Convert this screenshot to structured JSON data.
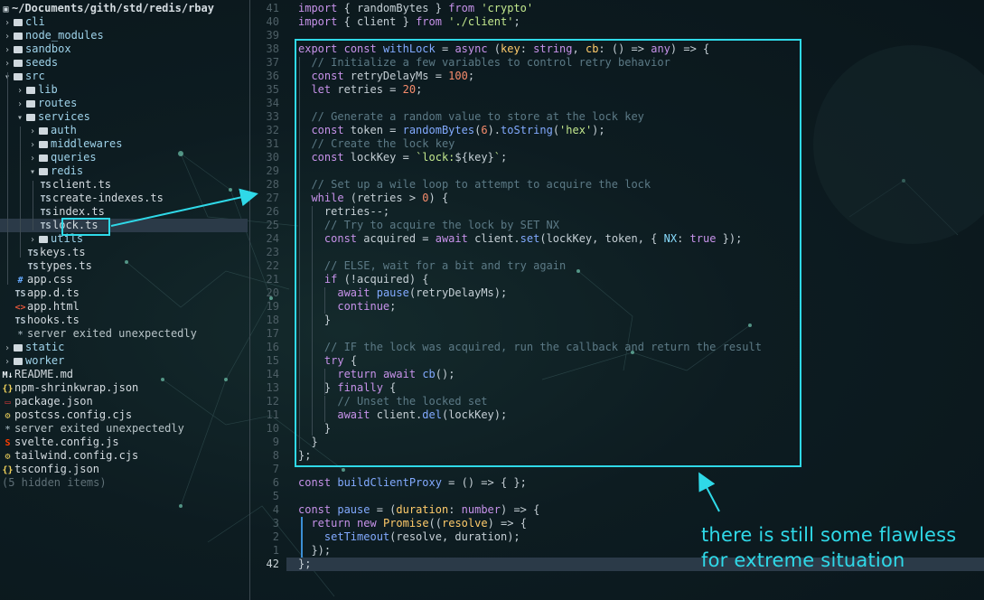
{
  "sidebar": {
    "header": "~/Documents/gith/std/redis/rbay",
    "items": [
      {
        "label": "cli",
        "type": "dir",
        "depth": 0,
        "open": false
      },
      {
        "label": "node_modules",
        "type": "dir",
        "depth": 0,
        "open": false
      },
      {
        "label": "sandbox",
        "type": "dir",
        "depth": 0,
        "open": false
      },
      {
        "label": "seeds",
        "type": "dir",
        "depth": 0,
        "open": false
      },
      {
        "label": "src",
        "type": "dir",
        "depth": 0,
        "open": true
      },
      {
        "label": "lib",
        "type": "dir",
        "depth": 1,
        "open": false
      },
      {
        "label": "routes",
        "type": "dir",
        "depth": 1,
        "open": false
      },
      {
        "label": "services",
        "type": "dir",
        "depth": 1,
        "open": true
      },
      {
        "label": "auth",
        "type": "dir",
        "depth": 2,
        "open": false
      },
      {
        "label": "middlewares",
        "type": "dir",
        "depth": 2,
        "open": false
      },
      {
        "label": "queries",
        "type": "dir",
        "depth": 2,
        "open": false
      },
      {
        "label": "redis",
        "type": "dir",
        "depth": 2,
        "open": true
      },
      {
        "label": "client.ts",
        "type": "ts",
        "depth": 3
      },
      {
        "label": "create-indexes.ts",
        "type": "ts",
        "depth": 3
      },
      {
        "label": "index.ts",
        "type": "ts",
        "depth": 3
      },
      {
        "label": "lock.ts",
        "type": "ts",
        "depth": 3,
        "selected": true
      },
      {
        "label": "utils",
        "type": "dir",
        "depth": 2,
        "open": false
      },
      {
        "label": "keys.ts",
        "type": "ts",
        "depth": 2
      },
      {
        "label": "types.ts",
        "type": "ts",
        "depth": 2
      },
      {
        "label": "app.css",
        "type": "css",
        "depth": 1
      },
      {
        "label": "app.d.ts",
        "type": "ts",
        "depth": 1
      },
      {
        "label": "app.html",
        "type": "html",
        "depth": 1
      },
      {
        "label": "hooks.ts",
        "type": "ts",
        "depth": 1
      },
      {
        "label": "server exited unexpectedly",
        "type": "msg",
        "depth": 1
      },
      {
        "label": "static",
        "type": "dir",
        "depth": 0,
        "open": false
      },
      {
        "label": "worker",
        "type": "dir",
        "depth": 0,
        "open": false
      },
      {
        "label": "README.md",
        "type": "md",
        "depth": 0
      },
      {
        "label": "npm-shrinkwrap.json",
        "type": "json",
        "depth": 0
      },
      {
        "label": "package.json",
        "type": "npm",
        "depth": 0
      },
      {
        "label": "postcss.config.cjs",
        "type": "cjs",
        "depth": 0
      },
      {
        "label": "server exited unexpectedly",
        "type": "msg",
        "depth": 0
      },
      {
        "label": "svelte.config.js",
        "type": "svelte",
        "depth": 0
      },
      {
        "label": "tailwind.config.cjs",
        "type": "cjs",
        "depth": 0
      },
      {
        "label": "tsconfig.json",
        "type": "json",
        "depth": 0
      },
      {
        "label": "(5 hidden items)",
        "type": "muted",
        "depth": 0
      }
    ]
  },
  "editor": {
    "line_numbers": [
      "41",
      "40",
      "39",
      "38",
      "37",
      "36",
      "35",
      "34",
      "33",
      "32",
      "31",
      "30",
      "29",
      "28",
      "27",
      "26",
      "25",
      "24",
      "23",
      "22",
      "21",
      "20",
      "19",
      "18",
      "17",
      "16",
      "15",
      "14",
      "13",
      "12",
      "11",
      "10",
      "9",
      "8",
      "7",
      "6",
      "5",
      "4",
      "3",
      "2",
      "1",
      "42"
    ],
    "current_line": "42",
    "lines": [
      [
        [
          "kw",
          "import"
        ],
        [
          "vr",
          " { randomBytes } "
        ],
        [
          "kw",
          "from"
        ],
        [
          "vr",
          " "
        ],
        [
          "str",
          "'crypto'"
        ]
      ],
      [
        [
          "kw",
          "import"
        ],
        [
          "vr",
          " { client } "
        ],
        [
          "kw",
          "from"
        ],
        [
          "vr",
          " "
        ],
        [
          "str",
          "'./client'"
        ],
        [
          "vr",
          ";"
        ]
      ],
      [],
      [
        [
          "kw",
          "export"
        ],
        [
          "vr",
          " "
        ],
        [
          "kw",
          "const"
        ],
        [
          "vr",
          " "
        ],
        [
          "fn",
          "withLock"
        ],
        [
          "vr",
          " = "
        ],
        [
          "kw",
          "async"
        ],
        [
          "vr",
          " ("
        ],
        [
          "ty",
          "key"
        ],
        [
          "vr",
          ": "
        ],
        [
          "kw",
          "string"
        ],
        [
          "vr",
          ", "
        ],
        [
          "ty",
          "cb"
        ],
        [
          "vr",
          ": () => "
        ],
        [
          "kw",
          "any"
        ],
        [
          "vr",
          ") => {"
        ]
      ],
      [
        [
          "vr",
          "  "
        ],
        [
          "cm",
          "// Initialize a few variables to control retry behavior"
        ]
      ],
      [
        [
          "vr",
          "  "
        ],
        [
          "kw",
          "const"
        ],
        [
          "vr",
          " retryDelayMs = "
        ],
        [
          "num",
          "100"
        ],
        [
          "vr",
          ";"
        ]
      ],
      [
        [
          "vr",
          "  "
        ],
        [
          "kw",
          "let"
        ],
        [
          "vr",
          " retries = "
        ],
        [
          "num",
          "20"
        ],
        [
          "vr",
          ";"
        ]
      ],
      [],
      [
        [
          "vr",
          "  "
        ],
        [
          "cm",
          "// Generate a random value to store at the lock key"
        ]
      ],
      [
        [
          "vr",
          "  "
        ],
        [
          "kw",
          "const"
        ],
        [
          "vr",
          " token = "
        ],
        [
          "fn",
          "randomBytes"
        ],
        [
          "vr",
          "("
        ],
        [
          "num",
          "6"
        ],
        [
          "vr",
          ")."
        ],
        [
          "fn",
          "toString"
        ],
        [
          "vr",
          "("
        ],
        [
          "str",
          "'hex'"
        ],
        [
          "vr",
          ");"
        ]
      ],
      [
        [
          "vr",
          "  "
        ],
        [
          "cm",
          "// Create the lock key"
        ]
      ],
      [
        [
          "vr",
          "  "
        ],
        [
          "kw",
          "const"
        ],
        [
          "vr",
          " lockKey = "
        ],
        [
          "str",
          "`lock:"
        ],
        [
          "vr",
          "${key}"
        ],
        [
          "str",
          "`"
        ],
        [
          "vr",
          ";"
        ]
      ],
      [],
      [
        [
          "vr",
          "  "
        ],
        [
          "cm",
          "// Set up a wile loop to attempt to acquire the lock"
        ]
      ],
      [
        [
          "vr",
          "  "
        ],
        [
          "kw",
          "while"
        ],
        [
          "vr",
          " (retries > "
        ],
        [
          "num",
          "0"
        ],
        [
          "vr",
          ") {"
        ]
      ],
      [
        [
          "vr",
          "    retries--;"
        ]
      ],
      [
        [
          "vr",
          "    "
        ],
        [
          "cm",
          "// Try to acquire the lock by SET NX"
        ]
      ],
      [
        [
          "vr",
          "    "
        ],
        [
          "kw",
          "const"
        ],
        [
          "vr",
          " acquired = "
        ],
        [
          "kw",
          "await"
        ],
        [
          "vr",
          " client."
        ],
        [
          "fn",
          "set"
        ],
        [
          "vr",
          "(lockKey, token, { "
        ],
        [
          "pr",
          "NX"
        ],
        [
          "vr",
          ": "
        ],
        [
          "kw",
          "true"
        ],
        [
          "vr",
          " });"
        ]
      ],
      [],
      [
        [
          "vr",
          "    "
        ],
        [
          "cm",
          "// ELSE, wait for a bit and try again"
        ]
      ],
      [
        [
          "vr",
          "    "
        ],
        [
          "kw",
          "if"
        ],
        [
          "vr",
          " (!acquired) {"
        ]
      ],
      [
        [
          "vr",
          "      "
        ],
        [
          "kw",
          "await"
        ],
        [
          "vr",
          " "
        ],
        [
          "fn",
          "pause"
        ],
        [
          "vr",
          "(retryDelayMs);"
        ]
      ],
      [
        [
          "vr",
          "      "
        ],
        [
          "kw",
          "continue"
        ],
        [
          "vr",
          ";"
        ]
      ],
      [
        [
          "vr",
          "    }"
        ]
      ],
      [],
      [
        [
          "vr",
          "    "
        ],
        [
          "cm",
          "// IF the lock was acquired, run the callback and return the result"
        ]
      ],
      [
        [
          "vr",
          "    "
        ],
        [
          "kw",
          "try"
        ],
        [
          "vr",
          " {"
        ]
      ],
      [
        [
          "vr",
          "      "
        ],
        [
          "kw",
          "return"
        ],
        [
          "vr",
          " "
        ],
        [
          "kw",
          "await"
        ],
        [
          "vr",
          " "
        ],
        [
          "fn",
          "cb"
        ],
        [
          "vr",
          "();"
        ]
      ],
      [
        [
          "vr",
          "    } "
        ],
        [
          "kw",
          "finally"
        ],
        [
          "vr",
          " {"
        ]
      ],
      [
        [
          "vr",
          "      "
        ],
        [
          "cm",
          "// Unset the locked set"
        ]
      ],
      [
        [
          "vr",
          "      "
        ],
        [
          "kw",
          "await"
        ],
        [
          "vr",
          " client."
        ],
        [
          "fn",
          "del"
        ],
        [
          "vr",
          "(lockKey);"
        ]
      ],
      [
        [
          "vr",
          "    }"
        ]
      ],
      [
        [
          "vr",
          "  }"
        ]
      ],
      [
        [
          "vr",
          "};"
        ]
      ],
      [],
      [
        [
          "kw",
          "const"
        ],
        [
          "vr",
          " "
        ],
        [
          "fn",
          "buildClientProxy"
        ],
        [
          "vr",
          " = () => { };"
        ]
      ],
      [],
      [
        [
          "kw",
          "const"
        ],
        [
          "vr",
          " "
        ],
        [
          "fn",
          "pause"
        ],
        [
          "vr",
          " = ("
        ],
        [
          "ty",
          "duration"
        ],
        [
          "vr",
          ": "
        ],
        [
          "kw",
          "number"
        ],
        [
          "vr",
          ") => {"
        ]
      ],
      [
        [
          "vr",
          "  "
        ],
        [
          "kw",
          "return"
        ],
        [
          "vr",
          " "
        ],
        [
          "kw",
          "new"
        ],
        [
          "vr",
          " "
        ],
        [
          "ty",
          "Promise"
        ],
        [
          "vr",
          "(("
        ],
        [
          "ty",
          "resolve"
        ],
        [
          "vr",
          ") => {"
        ]
      ],
      [
        [
          "vr",
          "    "
        ],
        [
          "fn",
          "setTimeout"
        ],
        [
          "vr",
          "(resolve, duration);"
        ]
      ],
      [
        [
          "vr",
          "  });"
        ]
      ],
      [
        [
          "vr",
          "};"
        ]
      ]
    ]
  },
  "annotation": {
    "note_line1": "there is still some flawless",
    "note_line2": "for extreme situation",
    "color": "#2fd9e8"
  },
  "icons": {
    "dir": "folder-icon",
    "ts": "typescript-file-icon",
    "css": "css-file-icon",
    "html": "html-file-icon",
    "md": "markdown-file-icon",
    "json": "json-file-icon",
    "npm": "npm-file-icon",
    "cjs": "config-file-icon",
    "svelte": "svelte-file-icon",
    "msg": "asterisk-icon"
  }
}
